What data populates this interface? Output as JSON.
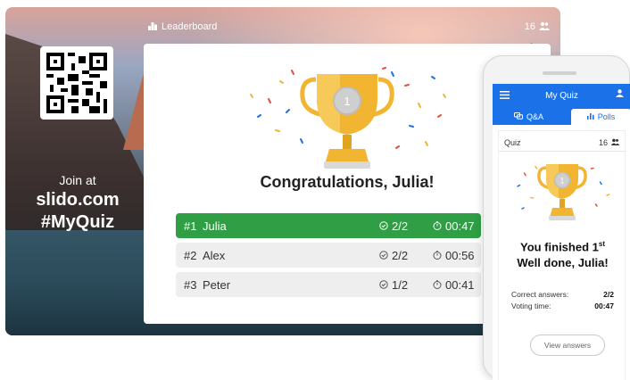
{
  "screen": {
    "header": {
      "label": "Leaderboard",
      "participants": "16"
    },
    "join": {
      "line1": "Join at",
      "line2": "slido.com",
      "line3": "#MyQuiz"
    },
    "trophy_rank": "1",
    "congrats": "Congratulations, Julia!",
    "leaderboard": [
      {
        "rank": "#1",
        "name": "Julia",
        "score": "2/2",
        "time": "00:47"
      },
      {
        "rank": "#2",
        "name": "Alex",
        "score": "2/2",
        "time": "00:56"
      },
      {
        "rank": "#3",
        "name": "Peter",
        "score": "1/2",
        "time": "00:41"
      }
    ]
  },
  "phone": {
    "title": "My Quiz",
    "tabs": {
      "qa": "Q&A",
      "polls": "Polls"
    },
    "quiz_label": "Quiz",
    "participants": "16",
    "trophy_rank": "1",
    "finished_line": "You finished 1",
    "finished_sup": "st",
    "well_done": "Well done, Julia!",
    "stats": [
      {
        "label": "Correct answers:",
        "value": "2/2"
      },
      {
        "label": "Voting time:",
        "value": "00:47"
      }
    ],
    "view_answers": "View answers"
  },
  "colors": {
    "accent": "#1b72e8",
    "winner": "#2f9e44",
    "trophy": "#f2b531"
  }
}
